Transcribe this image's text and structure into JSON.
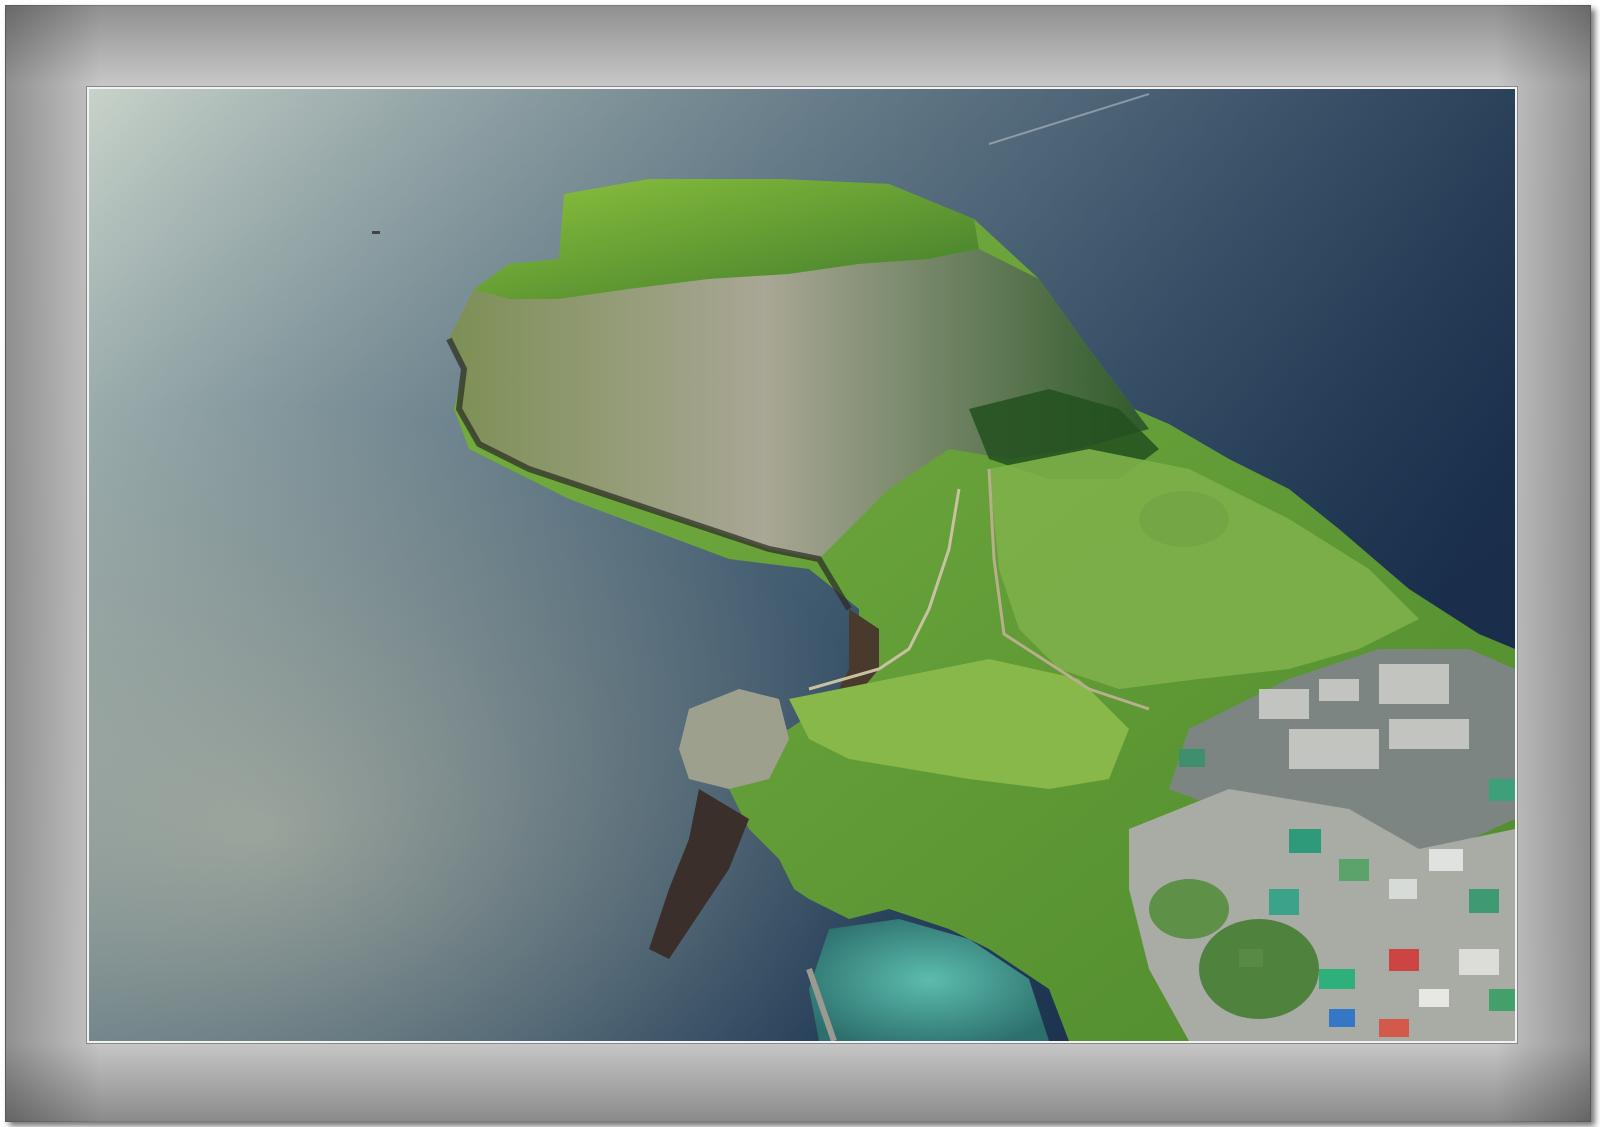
{
  "image": {
    "subject": "aerial-coastal-headland",
    "colors": {
      "frame": "#c4c4c4",
      "sea_light": "#b8c7bf",
      "sea_dark": "#1c3650",
      "grass": "#6fa23a",
      "cliff": "#8b8a78",
      "lagoon": "#4aa39a",
      "town": "#b6b8b4"
    }
  }
}
